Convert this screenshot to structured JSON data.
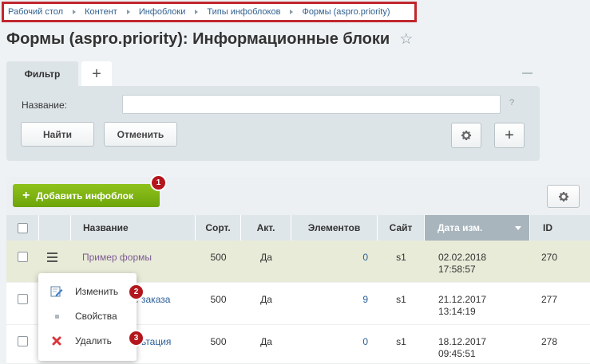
{
  "breadcrumb": [
    "Рабочий стол",
    "Контент",
    "Инфоблоки",
    "Типы инфоблоков",
    "Формы (aspro.priority)"
  ],
  "page": {
    "title": "Формы (aspro.priority): Информационные блоки",
    "star": "☆"
  },
  "filter": {
    "tab_label": "Фильтр",
    "add_tab_label": "+",
    "name_label": "Название:",
    "name_value": "",
    "help": "?",
    "find_label": "Найти",
    "cancel_label": "Отменить",
    "plus_label": "+"
  },
  "toolbar": {
    "add_label": "Добавить инфоблок",
    "add_plus": "+"
  },
  "badges": [
    "1",
    "2",
    "3"
  ],
  "table": {
    "columns": [
      "Название",
      "Сорт.",
      "Акт.",
      "Элементов",
      "Сайт",
      "Дата изм.",
      "ID"
    ],
    "rows": [
      {
        "name": "Пример формы",
        "sort": "500",
        "active": "Да",
        "elements": "0",
        "site": "s1",
        "date": "02.02.2018",
        "time": "17:58:57",
        "id": "270"
      },
      {
        "name": "е заказа",
        "sort": "500",
        "active": "Да",
        "elements": "9",
        "site": "s1",
        "date": "21.12.2017",
        "time": "13:14:19",
        "id": "277"
      },
      {
        "name": "ьтация",
        "sort": "500",
        "active": "Да",
        "elements": "0",
        "site": "s1",
        "date": "18.12.2017",
        "time": "09:45:51",
        "id": "278"
      }
    ]
  },
  "context_menu": {
    "items": [
      {
        "label": "Изменить",
        "icon": "edit-icon"
      },
      {
        "label": "Свойства",
        "icon": "bullet-icon"
      },
      {
        "label": "Удалить",
        "icon": "delete-icon"
      }
    ]
  },
  "colors": {
    "accent_green": "#7ab317",
    "badge_red": "#b3161c",
    "breadcrumb_border": "#c0272d"
  }
}
